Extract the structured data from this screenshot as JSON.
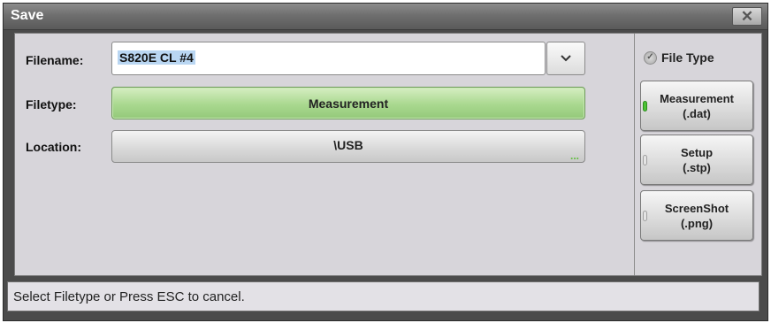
{
  "dialog": {
    "title": "Save",
    "close_icon": "close-x-icon"
  },
  "form": {
    "filename_label": "Filename:",
    "filename_value": "S820E CL #4",
    "filetype_label": "Filetype:",
    "filetype_value": "Measurement",
    "location_label": "Location:",
    "location_value": "\\USB",
    "location_more": "..."
  },
  "file_type_panel": {
    "header": "File Type",
    "options": [
      {
        "line1": "Measurement",
        "line2": "(.dat)",
        "selected": true
      },
      {
        "line1": "Setup",
        "line2": "(.stp)",
        "selected": false
      },
      {
        "line1": "ScreenShot",
        "line2": "(.png)",
        "selected": false
      }
    ]
  },
  "status": {
    "message": "Select Filetype or Press ESC to cancel."
  },
  "colors": {
    "selected_green": "#a9d88f",
    "led_on": "#4cc235"
  }
}
